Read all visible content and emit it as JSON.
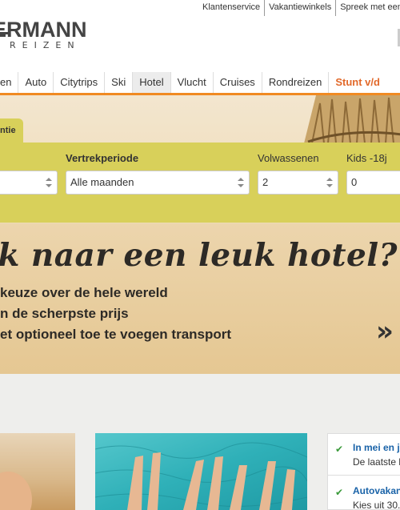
{
  "toplinks": [
    "Klantenservice",
    "Vakantiewinkels",
    "Spreek met een vak"
  ],
  "logo": {
    "line1": "ERMANN",
    "line2": "REIZEN"
  },
  "nav": [
    "en",
    "Auto",
    "Citytrips",
    "Ski",
    "Hotel",
    "Vlucht",
    "Cruises",
    "Rondreizen",
    "Stunt v/d"
  ],
  "search": {
    "tab_label": "ntie",
    "period_label": "Vertrekperiode",
    "period_value": "Alle maanden",
    "adults_label": "Volwassenen",
    "adults_value": "2",
    "kids_label": "Kids -18j",
    "kids_value": "0"
  },
  "hero": {
    "title": "ek naar een leuk hotel?",
    "lines": [
      "keuze over de hele wereld",
      "n de scherpste prijs",
      "et optioneel toe te voegen transport"
    ],
    "arrow": "»"
  },
  "usp": [
    {
      "title": "In mei en ju",
      "text": "De laatste k"
    },
    {
      "title": "Autovakan",
      "text": "Kies uit 30."
    }
  ],
  "colors": {
    "nav_accent": "#f08a22",
    "search_bg": "#d8d05a",
    "stunt_text": "#e2692a",
    "usp_title": "#1a63a8"
  }
}
